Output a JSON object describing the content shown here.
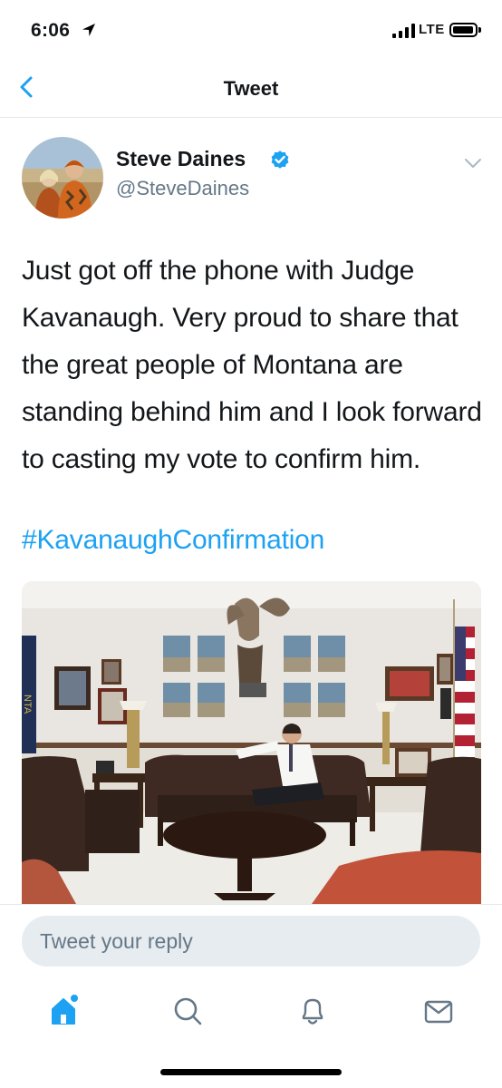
{
  "status_bar": {
    "time": "6:06",
    "network": "LTE"
  },
  "nav": {
    "title": "Tweet",
    "back_icon": "chevron-left-icon"
  },
  "tweet": {
    "author_name": "Steve Daines",
    "handle": "@SteveDaines",
    "verified": true,
    "text": "Just got off the phone with Judge Kavanaugh. Very proud to share that the great people of Montana are standing behind him and I look forward to casting my vote to confirm him.",
    "hashtag": "#KavanaughConfirmation",
    "media_flag_text": "NTA"
  },
  "reply": {
    "placeholder": "Tweet your reply"
  },
  "tabbar": {
    "items": [
      "home-icon",
      "search-icon",
      "notifications-bell-icon",
      "messages-envelope-icon"
    ]
  },
  "colors": {
    "accent": "#1da1f2",
    "secondary_text": "#657786",
    "divider": "#e1e8ed",
    "reply_bg": "#e6ecf0"
  }
}
